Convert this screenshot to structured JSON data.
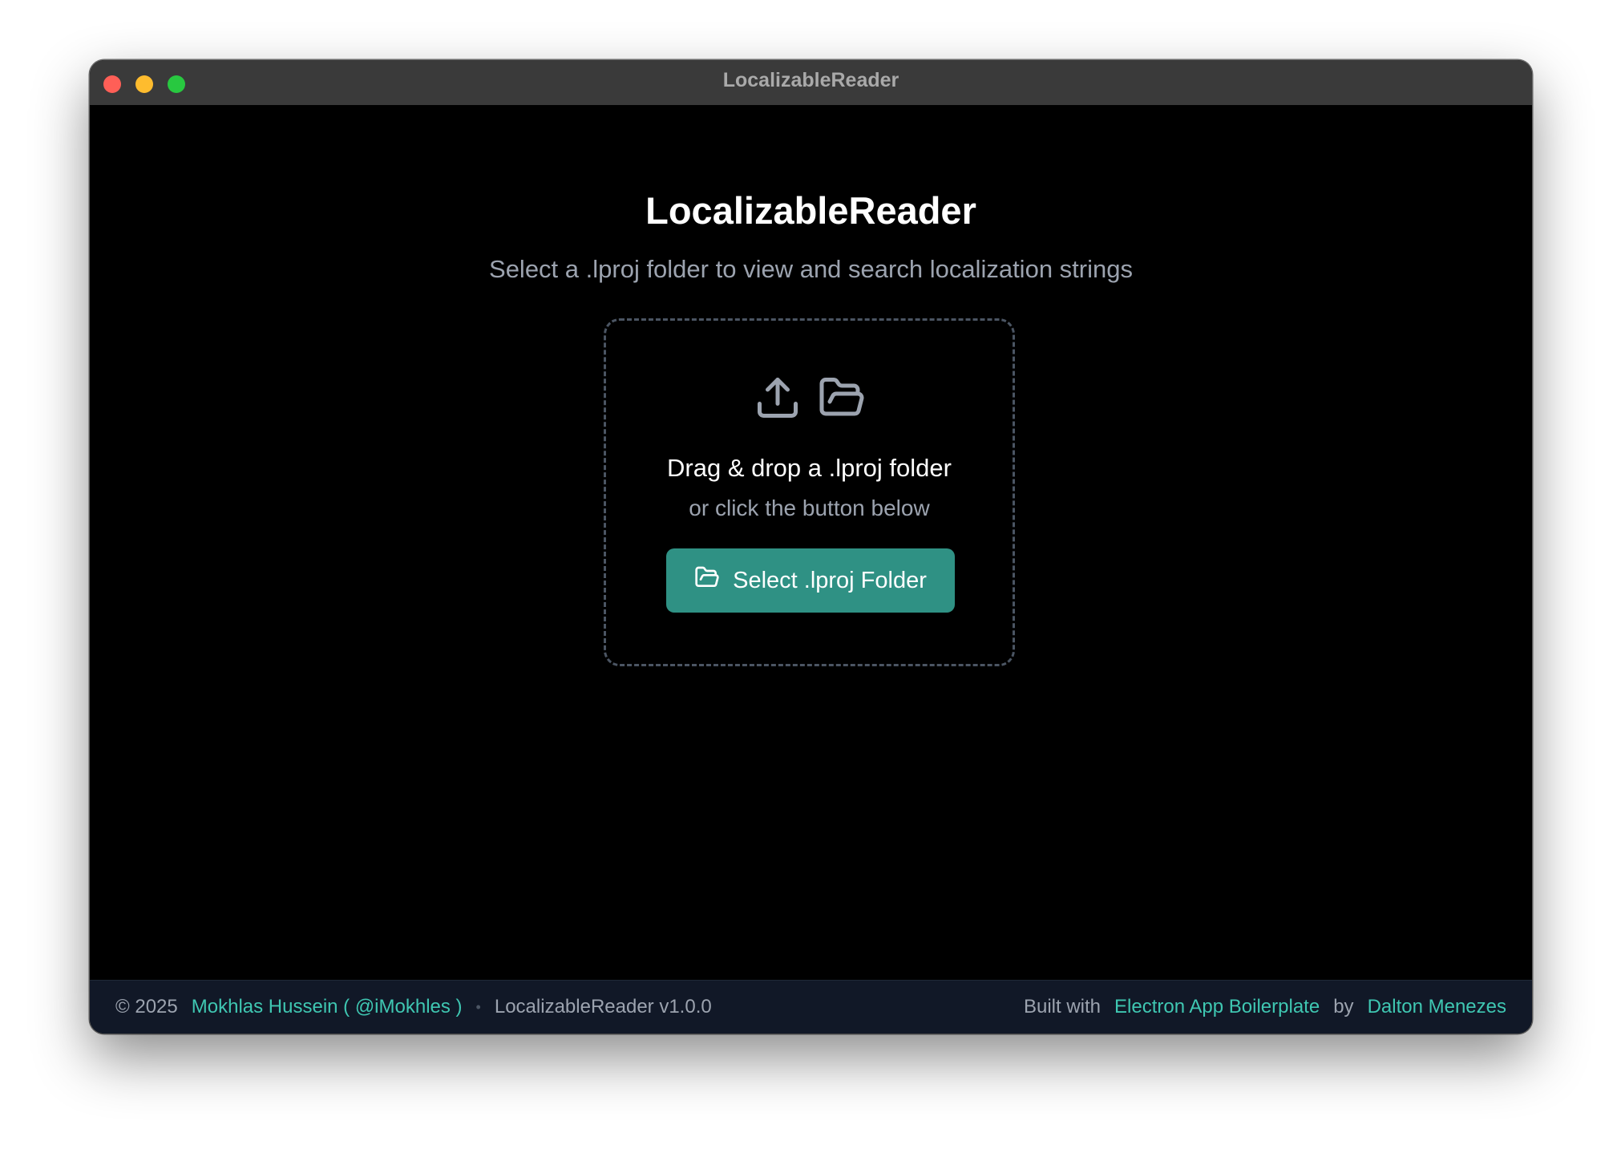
{
  "window": {
    "title": "LocalizableReader"
  },
  "main": {
    "title": "LocalizableReader",
    "subtitle": "Select a .lproj folder to view and search localization strings"
  },
  "dropzone": {
    "icons": [
      "upload-icon",
      "folder-open-icon"
    ],
    "title": "Drag & drop a .lproj folder",
    "hint": "or click the button below",
    "button_label": "Select .lproj Folder",
    "button_icon": "folder-open-icon"
  },
  "footer": {
    "copyright": "© 2025",
    "author_link": "Mokhlas Hussein ( @iMokhles )",
    "separator": "•",
    "version": "LocalizableReader v1.0.0",
    "built_with": "Built with",
    "boilerplate_link": "Electron App Boilerplate",
    "by": "by",
    "boilerplate_author_link": "Dalton Menezes"
  },
  "colors": {
    "accent": "#2f9184",
    "link": "#3fc7b2",
    "background": "#000000",
    "footer_bg": "#111827",
    "titlebar_bg": "#3a3a3a"
  }
}
